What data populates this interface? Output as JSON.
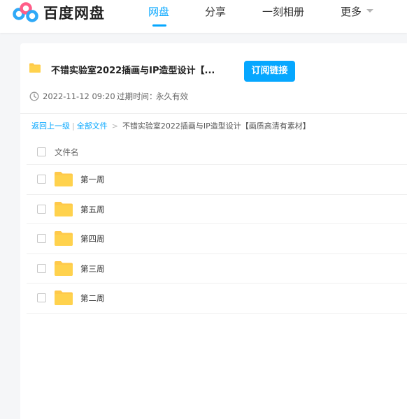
{
  "brand": {
    "logo_text": "百度网盘",
    "colors": {
      "accent": "#06a7ff",
      "logo_blue": "#2fa9f7",
      "logo_pink": "#ff5d88",
      "folder": "#ffd24d"
    }
  },
  "nav": {
    "items": [
      {
        "label": "网盘",
        "active": true
      },
      {
        "label": "分享",
        "active": false
      },
      {
        "label": "一刻相册",
        "active": false
      },
      {
        "label": "更多",
        "active": false
      }
    ]
  },
  "share": {
    "title": "不错实验室2022插画与IP造型设计【...",
    "subscribe_label": "订阅链接",
    "date": "2022-11-12 09:20",
    "expire_label": "过期时间：",
    "expire_value": "永久有效"
  },
  "breadcrumb": {
    "back": "返回上一级",
    "sep1": "|",
    "all_files": "全部文件",
    "sep2": ">",
    "current": "不错实验室2022插画与IP造型设计【画质高清有素材】"
  },
  "list": {
    "column_name": "文件名",
    "rows": [
      {
        "name": "第一周",
        "type": "folder-icon"
      },
      {
        "name": "第五周",
        "type": "folder-icon"
      },
      {
        "name": "第四周",
        "type": "folder-icon"
      },
      {
        "name": "第三周",
        "type": "folder-icon"
      },
      {
        "name": "第二周",
        "type": "folder-icon"
      }
    ]
  }
}
